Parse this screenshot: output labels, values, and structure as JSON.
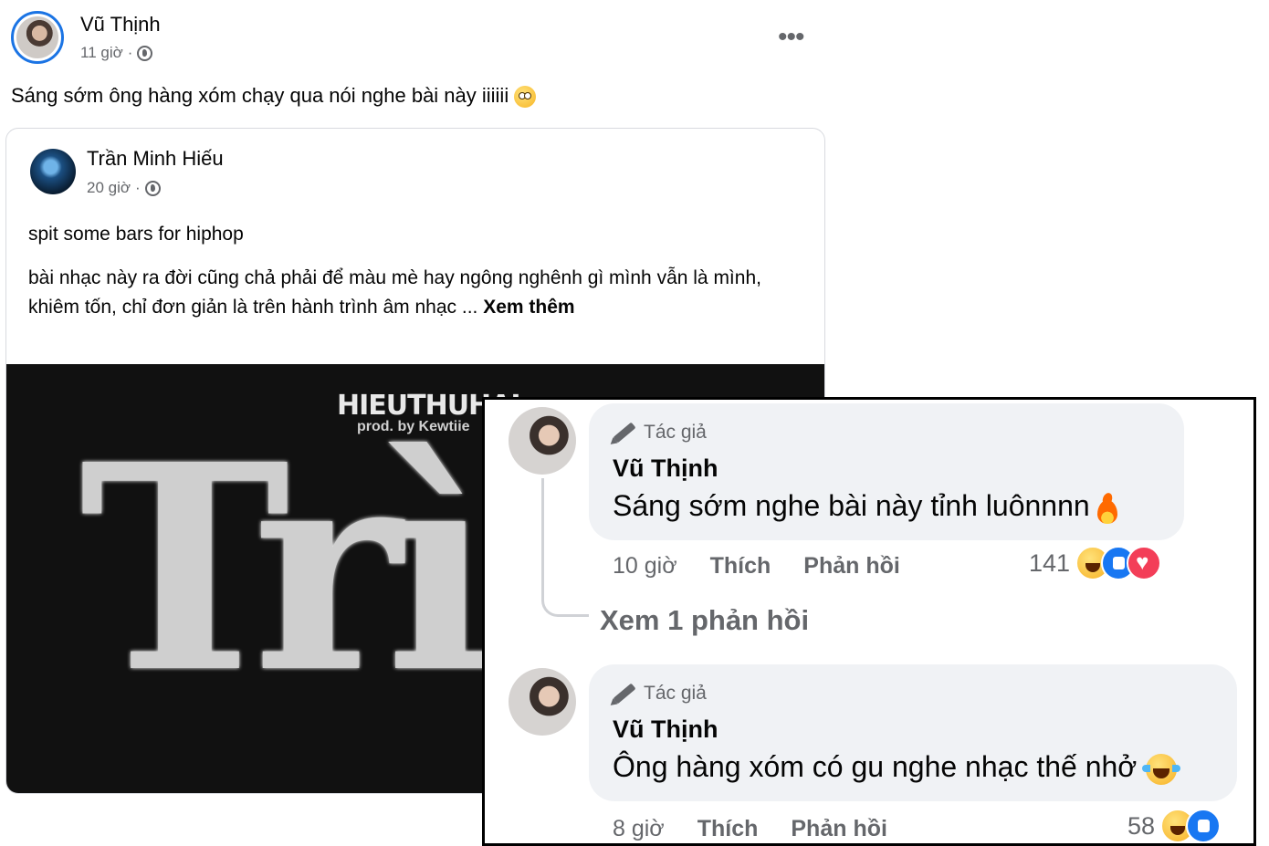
{
  "post": {
    "author": "Vũ Thịnh",
    "time": "11 giờ",
    "separator": "·",
    "more_label": "•••",
    "text": "Sáng sớm ông hàng xóm chạy qua nói nghe bài này iiiiii"
  },
  "shared": {
    "author": "Trần Minh Hiếu",
    "time": "20 giờ",
    "separator": "·",
    "line1": "spit some bars for hiphop",
    "line2": "bài nhạc này ra đời cũng chả phải để màu mè hay ngông nghênh gì mình vẫn là mình, khiêm tốn, chỉ đơn giản là trên hành trình âm nhạc ...",
    "see_more": "Xem thêm",
    "cover": {
      "artist": "HIEUTHUHAI",
      "producer": "prod. by Kewtiie",
      "title": "Trì"
    }
  },
  "comments": [
    {
      "badge": "Tác giả",
      "author": "Vũ Thịnh",
      "text": "Sáng sớm nghe bài này tỉnh luônnnn",
      "time": "10 giờ",
      "like_label": "Thích",
      "reply_label": "Phản hồi",
      "reaction_count": "141",
      "reactions": [
        "haha-icon",
        "like-icon",
        "love-icon"
      ]
    },
    {
      "badge": "Tác giả",
      "author": "Vũ Thịnh",
      "text": "Ông hàng xóm có gu nghe nhạc thế nhở",
      "time": "8 giờ",
      "like_label": "Thích",
      "reply_label": "Phản hồi",
      "reaction_count": "58",
      "reactions": [
        "haha-icon",
        "like-icon"
      ]
    }
  ],
  "view_replies": "Xem 1 phản hồi",
  "colors": {
    "accent": "#1b74e4",
    "secondary_text": "#65676b",
    "bubble": "#f0f2f5",
    "like": "#1877f2",
    "love": "#f33e58"
  }
}
